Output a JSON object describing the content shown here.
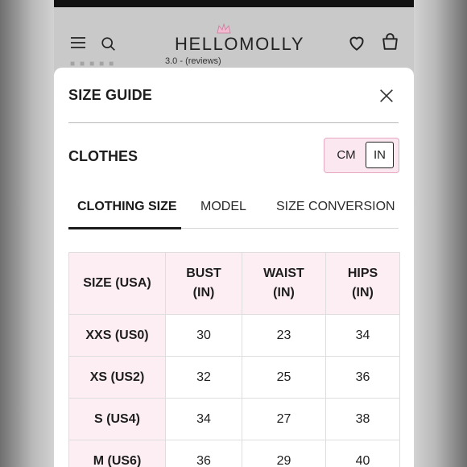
{
  "header": {
    "logo_text": "HELLOMOLLY",
    "behind_text": "3.0 - (reviews)",
    "icons": [
      "menu-icon",
      "search-icon",
      "crown-icon",
      "heart-icon",
      "bag-icon"
    ]
  },
  "modal": {
    "title": "SIZE GUIDE",
    "section": "CLOTHES",
    "units": {
      "cm": "CM",
      "in": "IN",
      "selected": "IN"
    },
    "tabs": [
      {
        "label": "CLOTHING SIZE",
        "active": true
      },
      {
        "label": "MODEL",
        "active": false
      },
      {
        "label": "SIZE CONVERSION",
        "active": false
      }
    ],
    "table": {
      "headers": [
        {
          "line1": "SIZE (USA)",
          "line2": ""
        },
        {
          "line1": "BUST",
          "line2": "(IN)"
        },
        {
          "line1": "WAIST",
          "line2": "(IN)"
        },
        {
          "line1": "HIPS",
          "line2": "(IN)"
        }
      ],
      "rows": [
        {
          "size": "XXS (US0)",
          "bust": "30",
          "waist": "23",
          "hips": "34"
        },
        {
          "size": "XS (US2)",
          "bust": "32",
          "waist": "25",
          "hips": "36"
        },
        {
          "size": "S (US4)",
          "bust": "34",
          "waist": "27",
          "hips": "38"
        },
        {
          "size": "M (US6)",
          "bust": "36",
          "waist": "29",
          "hips": "40"
        }
      ]
    }
  },
  "colors": {
    "accent_pink_bg": "#fdeef4",
    "accent_pink_border": "#e7a9c2",
    "text": "#1e1e1e"
  }
}
